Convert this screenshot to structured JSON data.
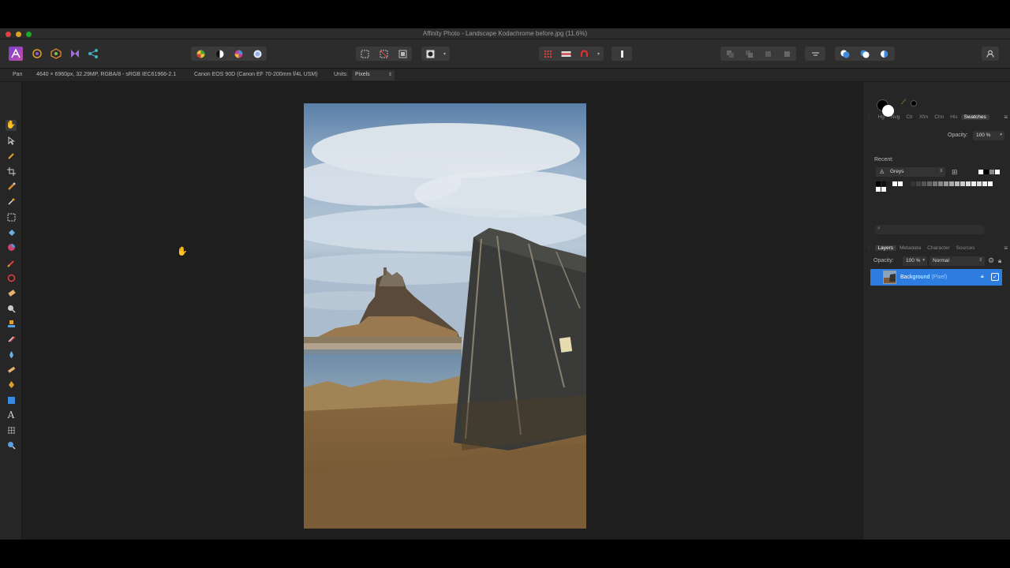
{
  "window": {
    "title": "Affinity Photo - Landscape Kodachrome before.jpg (11.6%)"
  },
  "context_bar": {
    "tool_name": "Pan",
    "doc_info": "4640 × 6960px, 32.29MP, RGBA/8 - sRGB IEC61966-2.1",
    "camera_info": "Canon EOS 90D (Canon EF 70-200mm f/4L USM)",
    "units_label": "Units:",
    "units_value": "Pixels"
  },
  "colour_panel": {
    "tabs": [
      "Hg",
      "Nvg",
      "Clr",
      "Xfm",
      "Chn",
      "His",
      "Swatches"
    ],
    "active_tab": "Swatches",
    "opacity_label": "Opacity:",
    "opacity_value": "100 %",
    "recent_label": "Recent:",
    "palette_value": "Greys",
    "primary_color": "#000000",
    "secondary_color": "#ffffff",
    "recent_colors": [
      "#ffffff",
      "#000000",
      "#888888",
      "#ffffff"
    ],
    "grey_swatches": [
      "#000000",
      "#111111",
      "#222222",
      "#333333",
      "#444444",
      "#555555",
      "#666666",
      "#777777",
      "#888888",
      "#999999",
      "#aaaaaa",
      "#bbbbbb",
      "#cccccc",
      "#dddddd",
      "#eeeeee",
      "#ffffff"
    ]
  },
  "layers_panel": {
    "tabs": [
      "Layers",
      "Metadata",
      "Character",
      "Sources"
    ],
    "active_tab": "Layers",
    "opacity_label": "Opacity:",
    "opacity_value": "100 %",
    "blend_mode": "Normal",
    "layers": [
      {
        "name": "Background",
        "type": "(Pixel)",
        "visible": true,
        "selected": true
      }
    ]
  },
  "colors": {
    "accent": "#2d7de0",
    "chrome": "#2c2c2c",
    "canvas_bg": "#1e1e1e"
  }
}
